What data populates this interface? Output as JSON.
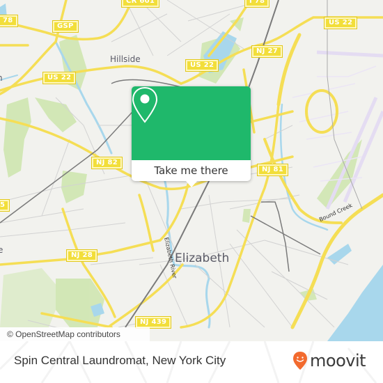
{
  "map": {
    "places": {
      "city": "Elizabeth",
      "town": "Hillside",
      "partial_left_label_1": "n",
      "partial_left_label_2": "e"
    },
    "road_shields": [
      {
        "id": "i78-left",
        "label": "78"
      },
      {
        "id": "gsp",
        "label": "GSP"
      },
      {
        "id": "cr601",
        "label": "CR 601"
      },
      {
        "id": "i78-top",
        "label": "I 78"
      },
      {
        "id": "us22-topright",
        "label": "US 22"
      },
      {
        "id": "nj27",
        "label": "NJ 27"
      },
      {
        "id": "us22-center",
        "label": "US 22"
      },
      {
        "id": "us22-left",
        "label": "US 22"
      },
      {
        "id": "nj82",
        "label": "NJ 82"
      },
      {
        "id": "nj81",
        "label": "NJ 81"
      },
      {
        "id": "nj28",
        "label": "NJ 28"
      },
      {
        "id": "nj439",
        "label": "NJ 439"
      },
      {
        "id": "left-edge",
        "label": "5"
      }
    ],
    "water_labels": {
      "elizabeth_river": "Elizabeth River",
      "bound_creek": "Bound Creek"
    },
    "attribution": "© OpenStreetMap contributors"
  },
  "popup": {
    "icon": "map-pin-icon",
    "button_label": "Take me there",
    "color": "#1fb86b"
  },
  "footer": {
    "title": "Spin Central Laundromat, New York City",
    "brand": "moovit",
    "brand_color": "#f26a2e"
  }
}
